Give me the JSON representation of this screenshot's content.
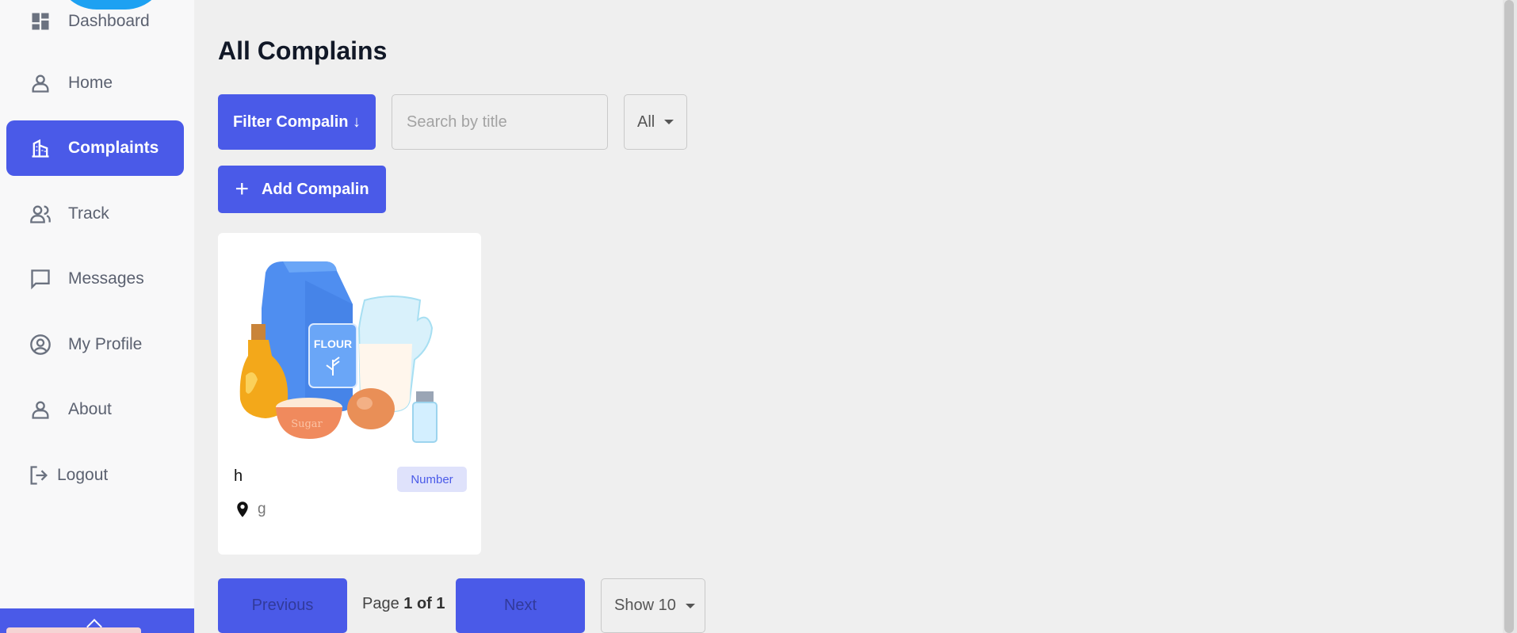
{
  "sidebar": {
    "items": [
      {
        "label": "Dashboard",
        "icon": "dashboard-icon"
      },
      {
        "label": "Home",
        "icon": "person-icon"
      },
      {
        "label": "Complaints",
        "icon": "building-icon",
        "active": true
      },
      {
        "label": "Track",
        "icon": "people-icon"
      },
      {
        "label": "Messages",
        "icon": "message-icon"
      },
      {
        "label": "My Profile",
        "icon": "account-circle-icon"
      },
      {
        "label": "About",
        "icon": "person-icon"
      },
      {
        "label": "Logout",
        "icon": "logout-icon"
      }
    ]
  },
  "main": {
    "title": "All Complains",
    "filter_button": "Filter Compalin ↓",
    "search_placeholder": "Search by title",
    "status_select": "All",
    "add_button": "Add Compalin",
    "cards": [
      {
        "title": "h",
        "badge": "Number",
        "location": "g",
        "image": "flour-sugar-milk-eggs-illustration"
      }
    ],
    "pagination": {
      "previous": "Previous",
      "page_label": "Page",
      "page_value": "1 of 1",
      "next": "Next",
      "page_size": "Show 10"
    }
  },
  "colors": {
    "accent": "#4a5ae8",
    "background": "#efefef",
    "sidebar": "#f8f8f9",
    "badge_bg": "#dfe2fb"
  }
}
